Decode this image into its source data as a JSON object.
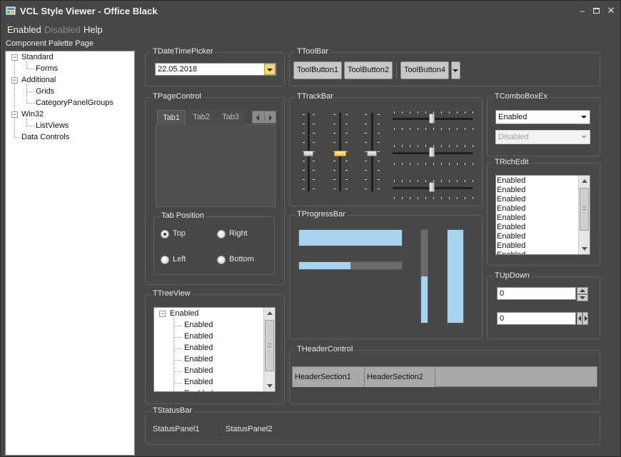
{
  "window": {
    "title": "VCL Style Viewer - Office Black"
  },
  "menu": {
    "items": [
      "Enabled",
      "Disabled",
      "Help"
    ]
  },
  "palette": {
    "title": "Component Palette Page",
    "nodes": [
      "Standard",
      "Forms",
      "Additional",
      "Grids",
      "CategoryPanelGroups",
      "Win32",
      "ListViews",
      "Data Controls"
    ]
  },
  "datetimepicker": {
    "title": "TDateTimePicker",
    "value": "22.05.2018"
  },
  "toolbar": {
    "title": "TToolBar",
    "buttons": [
      "ToolButton1",
      "ToolButton2",
      "ToolButton4"
    ]
  },
  "pagecontrol": {
    "title": "TPageControl",
    "tabs": [
      "Tab1",
      "Tab2",
      "Tab3"
    ]
  },
  "tabposition": {
    "title": "Tab Position",
    "options": [
      "Top",
      "Right",
      "Left",
      "Bottom"
    ],
    "selected": "Top"
  },
  "trackbar": {
    "title": "TTrackBar"
  },
  "comboboxex": {
    "title": "TComboBoxEx",
    "enabled_value": "Enabled",
    "disabled_value": "Disabled"
  },
  "richedit": {
    "title": "TRichEdit",
    "lines": [
      "Enabled",
      "Enabled",
      "Enabled",
      "Enabled",
      "Enabled",
      "Enabled",
      "Enabled",
      "Enabled",
      "Enabled"
    ]
  },
  "progressbar": {
    "title": "TProgressBar",
    "horizontal_full": 1.0,
    "horizontal_partial": 0.5,
    "vertical_partial": 0.5,
    "vertical_full": 1.0
  },
  "treeview": {
    "title": "TTreeView",
    "root": "Enabled",
    "children": [
      "Enabled",
      "Enabled",
      "Enabled",
      "Enabled",
      "Enabled",
      "Enabled",
      "Enabled"
    ]
  },
  "updown": {
    "title": "TUpDown",
    "value1": "0",
    "value2": "0"
  },
  "headercontrol": {
    "title": "THeaderControl",
    "sections": [
      "HeaderSection1",
      "HeaderSection2"
    ]
  },
  "statusbar": {
    "title": "TStatusBar",
    "panels": [
      "StatusPanel1",
      "StatusPanel2"
    ]
  },
  "colors": {
    "background": "#474747",
    "progress_fill": "#a8d4f0",
    "date_button": "#f5d77a"
  }
}
